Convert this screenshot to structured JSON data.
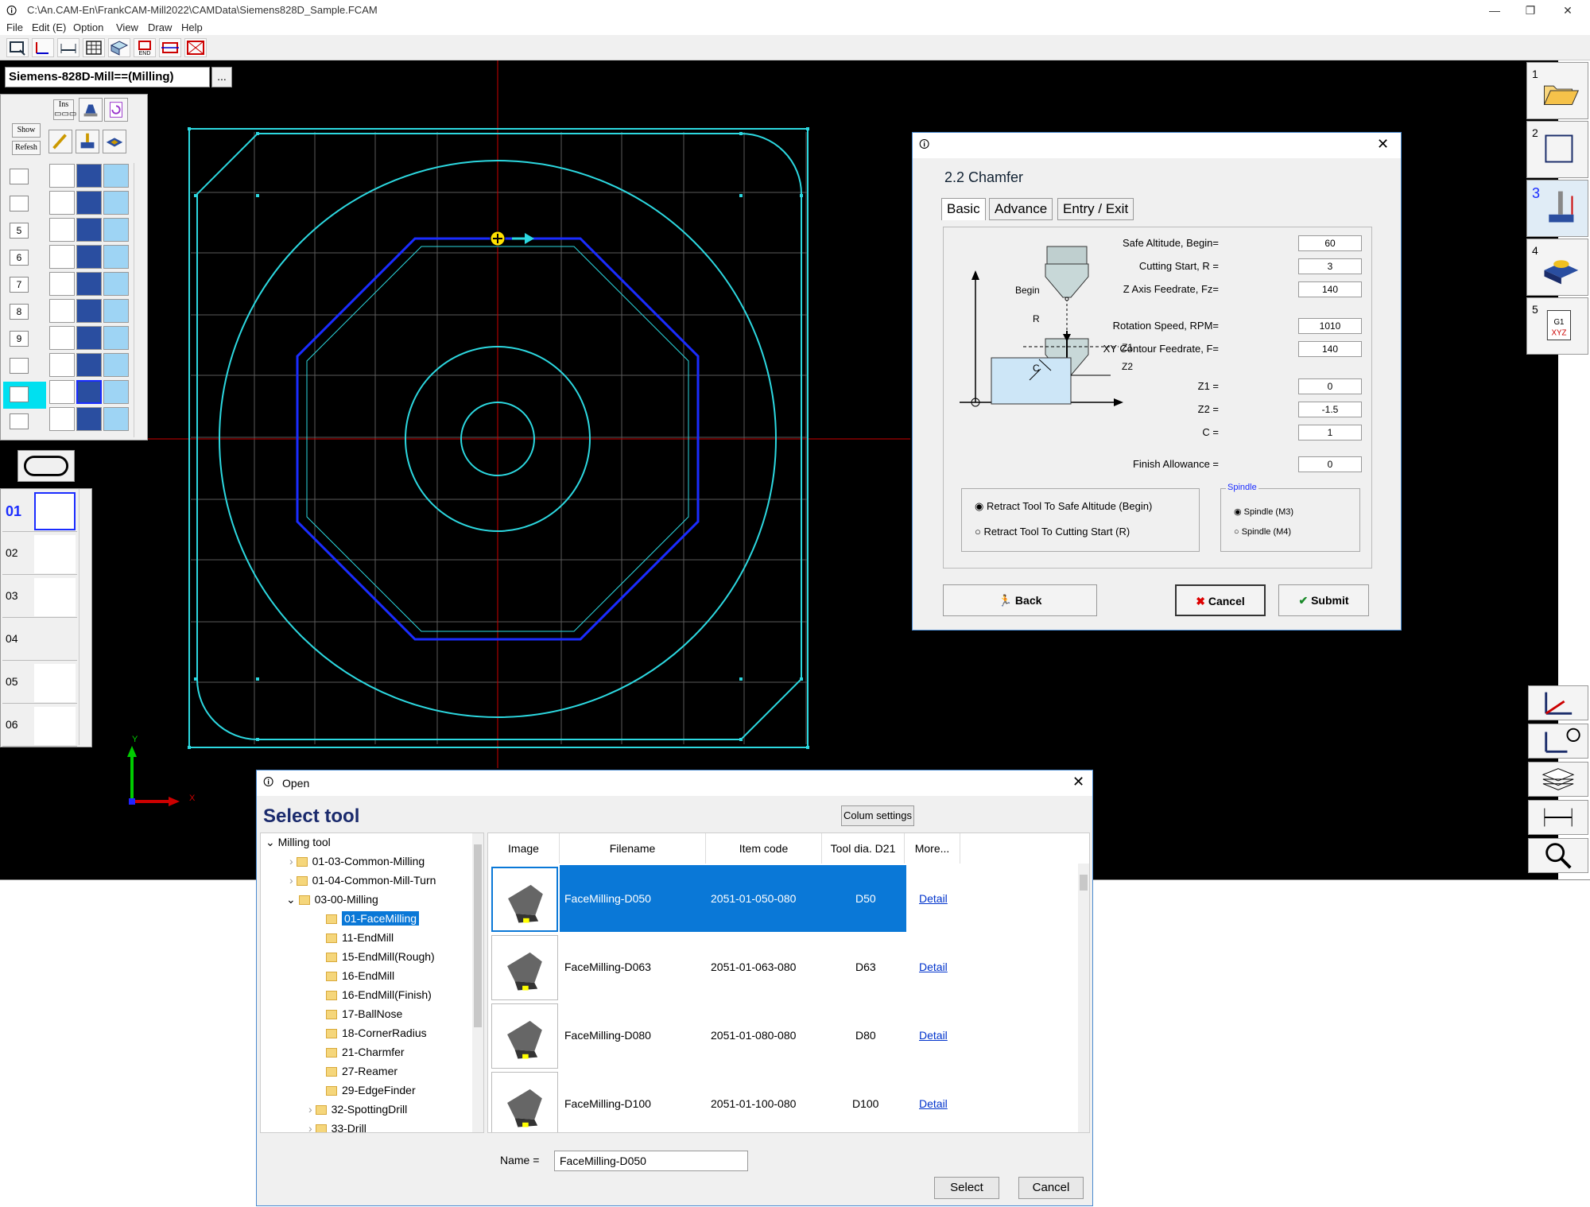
{
  "window": {
    "title": "C:\\An.CAM-En\\FrankCAM-Mill2022\\CAMData\\Siemens828D_Sample.FCAM"
  },
  "menu": [
    "File",
    "Edit (E)",
    "Option",
    "View",
    "Draw",
    "Help"
  ],
  "machine": {
    "name": "Siemens-828D-Mill==(Milling)",
    "button": "..."
  },
  "op_panel": {
    "top_buttons": [
      "Ins",
      "Show",
      "Refesh"
    ],
    "row_numbers": [
      "",
      "",
      "5",
      "6",
      "7",
      "8",
      "9",
      "",
      "",
      ""
    ]
  },
  "tools_slots": [
    "01",
    "02",
    "03",
    "04",
    "05",
    "06"
  ],
  "right_tools": [
    "1",
    "2",
    "3",
    "4",
    "5"
  ],
  "axes": {
    "x": "X",
    "y": "Y"
  },
  "chamfer_dialog": {
    "title": "2.2 Chamfer",
    "tabs": [
      "Basic",
      "Advance",
      "Entry / Exit"
    ],
    "diagram_labels": {
      "begin": "Begin",
      "r": "R",
      "c": "C",
      "z1": "Z1",
      "z2": "Z2"
    },
    "fields": {
      "safe_altitude": {
        "label": "Safe Altitude, Begin=",
        "value": "60"
      },
      "cutting_start": {
        "label": "Cutting Start, R =",
        "value": "3"
      },
      "z_feedrate": {
        "label": "Z Axis Feedrate, Fz=",
        "value": "140"
      },
      "rotation_speed": {
        "label": "Rotation Speed, RPM=",
        "value": "1010"
      },
      "xy_feedrate": {
        "label": "XY Contour Feedrate, F=",
        "value": "140"
      },
      "z1": {
        "label": "Z1 =",
        "value": "0"
      },
      "z2": {
        "label": "Z2 =",
        "value": "-1.5"
      },
      "c": {
        "label": "C =",
        "value": "1"
      },
      "finish_allowance": {
        "label": "Finish Allowance =",
        "value": "0"
      }
    },
    "retract": {
      "option1": "Retract Tool To Safe Altitude (Begin)",
      "option2": "Retract Tool To Cutting Start (R)"
    },
    "spindle": {
      "legend": "Spindle",
      "option1": "Spindle (M3)",
      "option2": "Spindle (M4)"
    },
    "buttons": {
      "back": "Back",
      "cancel": "Cancel",
      "submit": "Submit"
    }
  },
  "open_dialog": {
    "window_title": "Open",
    "heading": "Select tool",
    "column_settings": "Colum settings",
    "tree": [
      "Milling tool",
      "01-03-Common-Milling",
      "01-04-Common-Mill-Turn",
      "03-00-Milling",
      "01-FaceMilling",
      "11-EndMill",
      "15-EndMill(Rough)",
      "16-EndMill",
      "16-EndMill(Finish)",
      "17-BallNose",
      "18-CornerRadius",
      "21-Charmfer",
      "27-Reamer",
      "29-EdgeFinder",
      "32-SpottingDrill",
      "33-Drill"
    ],
    "columns": [
      "Image",
      "Filename",
      "Item code",
      "Tool dia. D21",
      "More..."
    ],
    "rows": [
      {
        "filename": "FaceMilling-D050",
        "code": "2051-01-050-080",
        "dia": "D50",
        "more": "Detail"
      },
      {
        "filename": "FaceMilling-D063",
        "code": "2051-01-063-080",
        "dia": "D63",
        "more": "Detail"
      },
      {
        "filename": "FaceMilling-D080",
        "code": "2051-01-080-080",
        "dia": "D80",
        "more": "Detail"
      },
      {
        "filename": "FaceMilling-D100",
        "code": "2051-01-100-080",
        "dia": "D100",
        "more": "Detail"
      }
    ],
    "name_label": "Name =",
    "name_value": "FaceMilling-D050",
    "select": "Select",
    "cancel": "Cancel"
  }
}
